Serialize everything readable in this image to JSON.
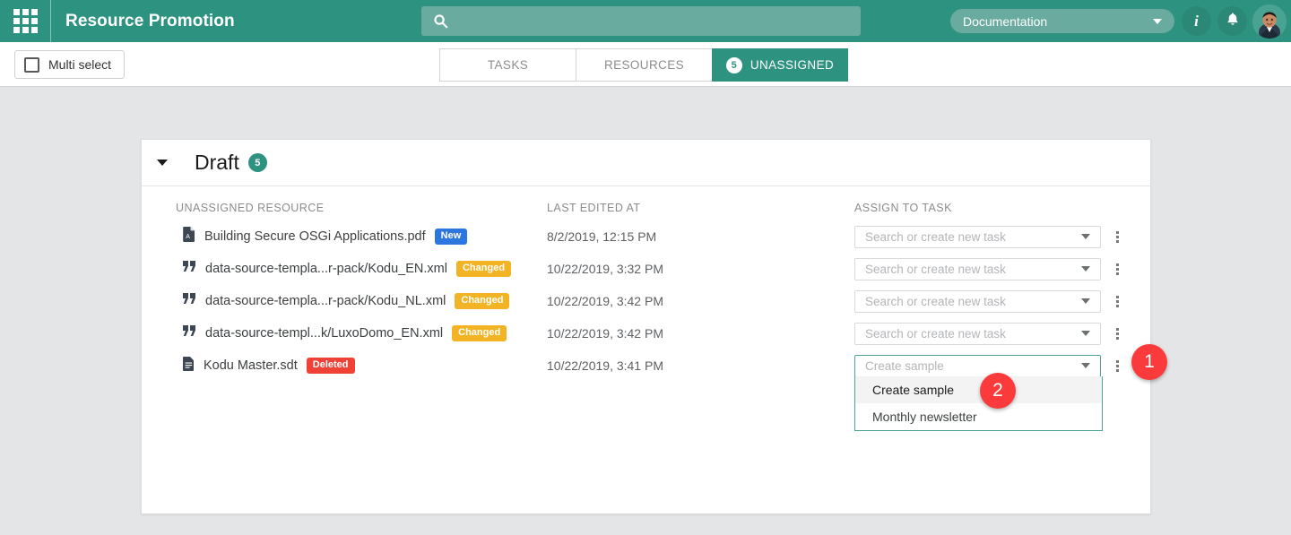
{
  "topbar": {
    "app_launcher_icon": "grid-apps-icon",
    "title": "Resource Promotion",
    "search": {
      "icon": "search-icon",
      "value": "",
      "placeholder": ""
    },
    "context_select": {
      "value": "Documentation",
      "caret_icon": "chevron-down-icon"
    },
    "info_icon": "info-icon",
    "info_glyph": "i",
    "bell_icon": "notification-bell-icon",
    "bell_glyph": "▲",
    "avatar": "user-avatar",
    "colors": {
      "bar": "#2e9280",
      "search_field": "#6aab9f",
      "icon_circle": "#2b8876"
    }
  },
  "toolbar": {
    "multi_select_label": "Multi select",
    "multi_select_checked": false,
    "tabs": [
      {
        "label": "TASKS",
        "active": false,
        "count": null
      },
      {
        "label": "RESOURCES",
        "active": false,
        "count": null
      },
      {
        "label": "UNASSIGNED",
        "active": true,
        "count": "5"
      }
    ]
  },
  "card": {
    "collapse_icon": "caret-down-icon",
    "title": "Draft",
    "count": "5",
    "columns": {
      "resource": "UNASSIGNED RESOURCE",
      "last_edited": "LAST EDITED AT",
      "assign": "ASSIGN TO TASK"
    },
    "rows": [
      {
        "icon": "pdf-file-icon",
        "name": "Building Secure OSGi Applications.pdf",
        "badge": "New",
        "badge_type": "new",
        "last_edited": "8/2/2019, 12:15 PM",
        "assign_placeholder": "Search or create new task",
        "assign_value": "",
        "dropdown_open": false
      },
      {
        "icon": "xml-file-icon",
        "name": "data-source-templa...r-pack/Kodu_EN.xml",
        "badge": "Changed",
        "badge_type": "changed",
        "last_edited": "10/22/2019, 3:32 PM",
        "assign_placeholder": "Search or create new task",
        "assign_value": "",
        "dropdown_open": false
      },
      {
        "icon": "xml-file-icon",
        "name": "data-source-templa...r-pack/Kodu_NL.xml",
        "badge": "Changed",
        "badge_type": "changed",
        "last_edited": "10/22/2019, 3:42 PM",
        "assign_placeholder": "Search or create new task",
        "assign_value": "",
        "dropdown_open": false
      },
      {
        "icon": "xml-file-icon",
        "name": "data-source-templ...k/LuxoDomo_EN.xml",
        "badge": "Changed",
        "badge_type": "changed",
        "last_edited": "10/22/2019, 3:42 PM",
        "assign_placeholder": "Search or create new task",
        "assign_value": "",
        "dropdown_open": false
      },
      {
        "icon": "document-file-icon",
        "name": "Kodu Master.sdt",
        "badge": "Deleted",
        "badge_type": "deleted",
        "last_edited": "10/22/2019, 3:41 PM",
        "assign_placeholder": "Create sample",
        "assign_value": "",
        "dropdown_open": true
      }
    ],
    "dropdown_options": [
      {
        "label": "Create sample",
        "highlighted": true
      },
      {
        "label": "Monthly newsletter",
        "highlighted": false
      }
    ]
  },
  "annotations": [
    {
      "label": "1"
    },
    {
      "label": "2"
    }
  ],
  "colors": {
    "accent": "#2e9280",
    "badge_new": "#2c76e0",
    "badge_changed": "#f2b324",
    "badge_deleted": "#ef4136",
    "marker": "#fb3b3b",
    "page_bg": "#e4e5e7"
  }
}
